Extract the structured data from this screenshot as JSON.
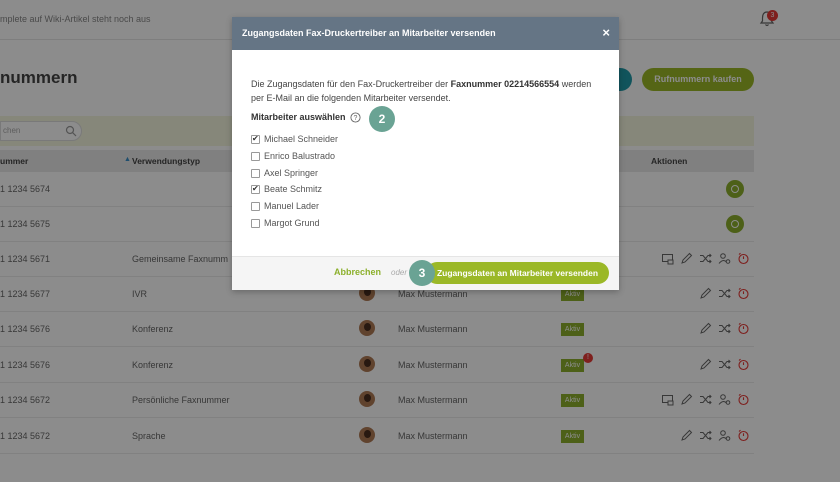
{
  "topbar": {
    "hint": "mplete auf Wiki-Artikel steht noch aus",
    "notification_count": "3"
  },
  "page": {
    "title": "nummern",
    "buy_button": "Rufnummern kaufen",
    "search_placeholder": "chen"
  },
  "table": {
    "headers": {
      "number": "ummer",
      "usage": "Verwendungstyp",
      "actions": "Aktionen"
    },
    "rows": [
      {
        "number": "1 1234 5674",
        "usage": "",
        "user": "",
        "status": ""
      },
      {
        "number": "1 1234 5675",
        "usage": "",
        "user": "",
        "status": ""
      },
      {
        "number": "1 1234 5671",
        "usage": "Gemeinsame Faxnumm",
        "user": "",
        "status": ""
      },
      {
        "number": "1 1234 5677",
        "usage": "IVR",
        "user": "Max Mustermann",
        "status": "Aktiv"
      },
      {
        "number": "1 1234 5676",
        "usage": "Konferenz",
        "user": "Max Mustermann",
        "status": "Aktiv"
      },
      {
        "number": "1 1234 5676",
        "usage": "Konferenz",
        "user": "Max Mustermann",
        "status": "Aktiv",
        "alert": "!"
      },
      {
        "number": "1 1234 5672",
        "usage": "Persönliche Faxnummer",
        "user": "Max Mustermann",
        "status": "Aktiv"
      },
      {
        "number": "1 1234 5672",
        "usage": "Sprache",
        "user": "Max Mustermann",
        "status": "Aktiv"
      }
    ]
  },
  "modal": {
    "title": "Zugangsdaten Fax-Druckertreiber an Mitarbeiter versenden",
    "close": "×",
    "text_before": "Die Zugangsdaten für den Fax-Druckertreiber der ",
    "fax_label": "Faxnummer 02214566554",
    "text_after": " werden per E-Mail an die folgenden Mitarbeiter versendet.",
    "select_label": "Mitarbeiter auswählen",
    "step_select": "2",
    "step_send": "3",
    "employees": [
      {
        "name": "Michael Schneider",
        "checked": true
      },
      {
        "name": "Enrico Balustrado",
        "checked": false
      },
      {
        "name": "Axel Springer",
        "checked": false
      },
      {
        "name": "Beate Schmitz",
        "checked": true
      },
      {
        "name": "Manuel Lader",
        "checked": false
      },
      {
        "name": "Margot Grund",
        "checked": false
      }
    ],
    "cancel": "Abbrechen",
    "or": "oder",
    "send": "Zugangsdaten an Mitarbeiter versenden"
  },
  "colors": {
    "accent_green": "#9bb827",
    "modal_header": "#657585",
    "step_badge": "#6aa394",
    "alert_red": "#e53935"
  }
}
